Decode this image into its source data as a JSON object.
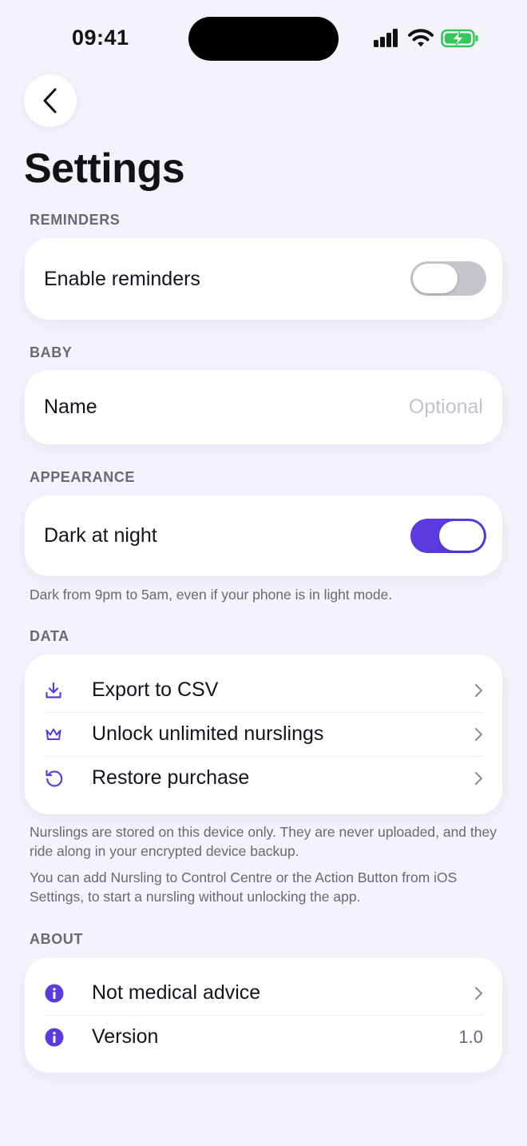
{
  "status_bar": {
    "time": "09:41"
  },
  "header": {
    "title": "Settings"
  },
  "sections": {
    "reminders": {
      "header": "REMINDERS",
      "enable_label": "Enable reminders",
      "enabled": false
    },
    "baby": {
      "header": "BABY",
      "name_label": "Name",
      "name_placeholder": "Optional"
    },
    "appearance": {
      "header": "APPEARANCE",
      "dark_label": "Dark at night",
      "dark_enabled": true,
      "note": "Dark from 9pm to 5am, even if your phone is in light mode."
    },
    "data": {
      "header": "DATA",
      "items": [
        {
          "label": "Export to CSV",
          "icon": "download-icon"
        },
        {
          "label": "Unlock unlimited nurslings",
          "icon": "crown-icon"
        },
        {
          "label": "Restore purchase",
          "icon": "restore-icon"
        }
      ],
      "note_1": "Nurslings are stored on this device only. They are never uploaded, and they ride along in your encrypted device backup.",
      "note_2": "You can add Nursling to Control Centre or the Action Button from iOS Settings, to start a nursling without unlocking the app."
    },
    "about": {
      "header": "ABOUT",
      "items": [
        {
          "label": "Not medical advice",
          "icon": "info-icon"
        },
        {
          "label": "Version",
          "icon": "info-icon",
          "value": "1.0"
        }
      ]
    }
  },
  "colors": {
    "accent": "#5a3be0",
    "background": "#f4f2fb",
    "toggle_off": "#c6c5cb"
  }
}
